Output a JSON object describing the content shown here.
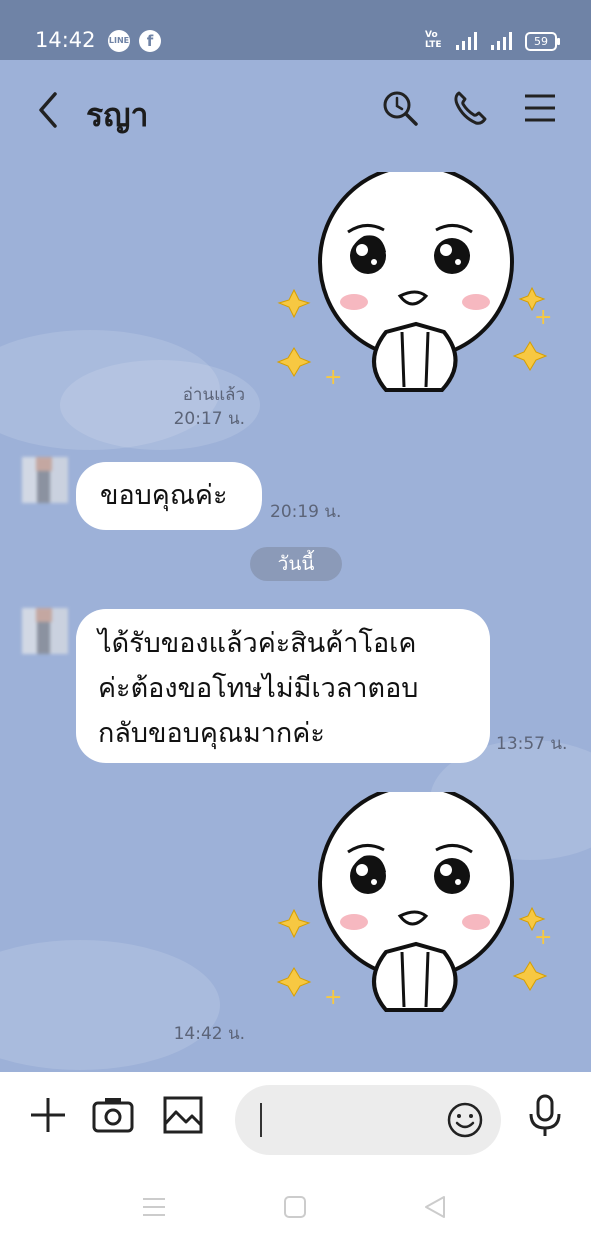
{
  "status_bar": {
    "time": "14:42",
    "line_icon_label": "LINE",
    "facebook_icon_label": "f",
    "volte_label_top": "Vo",
    "volte_label_bottom": "LTE",
    "battery": "59"
  },
  "header": {
    "contact_name": "รญา"
  },
  "messages": [
    {
      "type": "sticker",
      "side": "sent",
      "read_label": "อ่านแล้ว",
      "time": "20:17 น."
    },
    {
      "type": "text",
      "side": "received",
      "text": "ขอบคุณค่ะ",
      "time": "20:19 น."
    },
    {
      "type": "date",
      "text": "วันนี้"
    },
    {
      "type": "text",
      "side": "received",
      "text": "ได้รับของแล้วค่ะสินค้าโอเค\nค่ะต้องขอโทษไม่มีเวลาตอบ\nกลับขอบคุณมากค่ะ",
      "time": "13:57 น."
    },
    {
      "type": "sticker",
      "side": "received",
      "time": "14:42 น."
    }
  ],
  "input": {
    "placeholder": ""
  },
  "colors": {
    "status_bar": "#6f83a6",
    "chat_background": "#9db1d8",
    "bubble": "#ffffff",
    "meta_text": "#5c6478",
    "date_chip": "#8b9ab8"
  },
  "icons": [
    "back-arrow-icon",
    "search-icon",
    "phone-icon",
    "menu-icon",
    "plus-icon",
    "camera-icon",
    "image-icon",
    "emoji-icon",
    "microphone-icon",
    "nav-recents-icon",
    "nav-home-icon",
    "nav-back-icon"
  ]
}
